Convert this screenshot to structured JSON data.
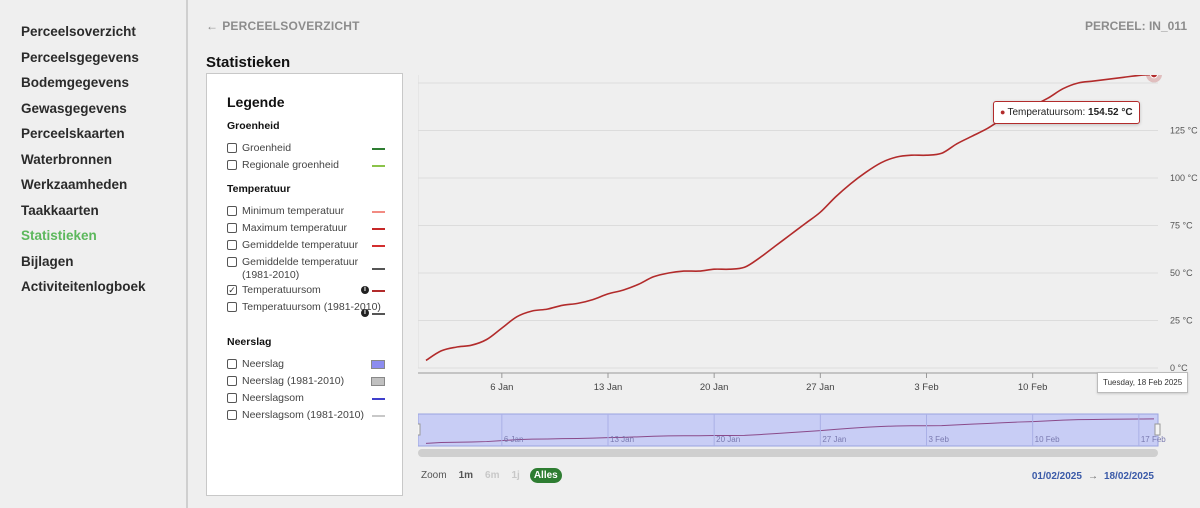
{
  "sidebar": {
    "items": [
      {
        "label": "Perceelsoverzicht",
        "active": false
      },
      {
        "label": "Perceelsgegevens",
        "active": false
      },
      {
        "label": "Bodemgegevens",
        "active": false
      },
      {
        "label": "Gewasgegevens",
        "active": false
      },
      {
        "label": "Perceelskaarten",
        "active": false
      },
      {
        "label": "Waterbronnen",
        "active": false
      },
      {
        "label": "Werkzaamheden",
        "active": false
      },
      {
        "label": "Taakkaarten",
        "active": false
      },
      {
        "label": "Statistieken",
        "active": true
      },
      {
        "label": "Bijlagen",
        "active": false
      },
      {
        "label": "Activiteitenlogboek",
        "active": false
      }
    ]
  },
  "header": {
    "back_label": "PERCEELSOVERZICHT",
    "parcel_label": "PERCEEL: IN_011",
    "page_title": "Statistieken"
  },
  "legend": {
    "title": "Legende",
    "groups": [
      {
        "title": "Groenheid",
        "items": [
          {
            "label": "Groenheid",
            "checked": false,
            "color": "#2e7d32",
            "style": "line"
          },
          {
            "label": "Regionale groenheid",
            "checked": false,
            "color": "#8bc34a",
            "style": "line"
          }
        ]
      },
      {
        "title": "Temperatuur",
        "items": [
          {
            "label": "Minimum temperatuur",
            "checked": false,
            "color": "#f28b82",
            "style": "line"
          },
          {
            "label": "Maximum temperatuur",
            "checked": false,
            "color": "#c62828",
            "style": "line"
          },
          {
            "label": "Gemiddelde temperatuur",
            "checked": false,
            "color": "#d32f2f",
            "style": "line"
          },
          {
            "label": "Gemiddelde temperatuur (1981-2010)",
            "checked": false,
            "color": "#555555",
            "style": "line"
          },
          {
            "label": "Temperatuursom",
            "checked": true,
            "color": "#b22b2b",
            "style": "line",
            "info": true
          },
          {
            "label": "Temperatuursom (1981-2010)",
            "checked": false,
            "color": "#555555",
            "style": "line",
            "info": true
          }
        ]
      },
      {
        "title": "Neerslag",
        "items": [
          {
            "label": "Neerslag",
            "checked": false,
            "color": "#8c8cf0",
            "style": "box"
          },
          {
            "label": "Neerslag (1981-2010)",
            "checked": false,
            "color": "#c0c0c0",
            "style": "box"
          },
          {
            "label": "Neerslagsom",
            "checked": false,
            "color": "#3f3fcc",
            "style": "line"
          },
          {
            "label": "Neerslagsom (1981-2010)",
            "checked": false,
            "color": "#c8c8c8",
            "style": "line"
          }
        ]
      }
    ]
  },
  "chart_data": {
    "type": "line",
    "ylabel": "Temperatuursom",
    "yunit": "°C",
    "ylim": [
      0,
      150
    ],
    "yticks": [
      "0 °C",
      "25 °C",
      "50 °C",
      "75 °C",
      "100 °C",
      "125 °C"
    ],
    "xlim": [
      "2025-01-01",
      "2025-02-18"
    ],
    "xticks": [
      "6 Jan",
      "13 Jan",
      "20 Jan",
      "27 Jan",
      "3 Feb",
      "10 Feb"
    ],
    "navigator_ticks": [
      "6 Jan",
      "13 Jan",
      "20 Jan",
      "27 Jan",
      "3 Feb",
      "10 Feb",
      "17 Feb"
    ],
    "grid": true,
    "series": [
      {
        "name": "Temperatuursom",
        "color": "#b22b2b",
        "points": [
          [
            "2025-01-01",
            4
          ],
          [
            "2025-01-02",
            9
          ],
          [
            "2025-01-03",
            11
          ],
          [
            "2025-01-04",
            12
          ],
          [
            "2025-01-05",
            15
          ],
          [
            "2025-01-06",
            21
          ],
          [
            "2025-01-07",
            27
          ],
          [
            "2025-01-08",
            30
          ],
          [
            "2025-01-09",
            31
          ],
          [
            "2025-01-10",
            33
          ],
          [
            "2025-01-11",
            34
          ],
          [
            "2025-01-12",
            36
          ],
          [
            "2025-01-13",
            39
          ],
          [
            "2025-01-14",
            41
          ],
          [
            "2025-01-15",
            44
          ],
          [
            "2025-01-16",
            48
          ],
          [
            "2025-01-17",
            50
          ],
          [
            "2025-01-18",
            51
          ],
          [
            "2025-01-19",
            51
          ],
          [
            "2025-01-20",
            52
          ],
          [
            "2025-01-21",
            52
          ],
          [
            "2025-01-22",
            53
          ],
          [
            "2025-01-23",
            58
          ],
          [
            "2025-01-24",
            64
          ],
          [
            "2025-01-25",
            70
          ],
          [
            "2025-01-26",
            76
          ],
          [
            "2025-01-27",
            82
          ],
          [
            "2025-01-28",
            90
          ],
          [
            "2025-01-29",
            97
          ],
          [
            "2025-01-30",
            103
          ],
          [
            "2025-01-31",
            108
          ],
          [
            "2025-02-01",
            111
          ],
          [
            "2025-02-02",
            112
          ],
          [
            "2025-02-03",
            112
          ],
          [
            "2025-02-04",
            113
          ],
          [
            "2025-02-05",
            118
          ],
          [
            "2025-02-06",
            122
          ],
          [
            "2025-02-07",
            126
          ],
          [
            "2025-02-08",
            131
          ],
          [
            "2025-02-09",
            135
          ],
          [
            "2025-02-10",
            138
          ],
          [
            "2025-02-11",
            142
          ],
          [
            "2025-02-12",
            147
          ],
          [
            "2025-02-13",
            150
          ],
          [
            "2025-02-14",
            151
          ],
          [
            "2025-02-15",
            152
          ],
          [
            "2025-02-16",
            153
          ],
          [
            "2025-02-17",
            154
          ],
          [
            "2025-02-18",
            154.52
          ]
        ]
      }
    ],
    "tooltip": {
      "series": "Temperatuursom",
      "value": "154.52 °C",
      "label": "Temperatuursom: ",
      "date": "Tuesday, 18 Feb 2025"
    }
  },
  "zoom": {
    "label": "Zoom",
    "buttons": [
      {
        "label": "1m",
        "state": "normal"
      },
      {
        "label": "6m",
        "state": "disabled"
      },
      {
        "label": "1j",
        "state": "disabled"
      },
      {
        "label": "Alles",
        "state": "active"
      }
    ],
    "range_from": "01/02/2025",
    "range_sep": "→",
    "range_to": "18/02/2025"
  }
}
